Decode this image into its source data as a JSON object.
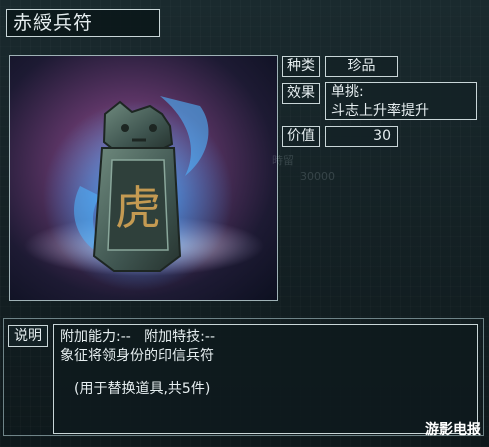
{
  "item": {
    "name": "赤綬兵符",
    "category_label": "种类",
    "category_value": "珍品",
    "effect_label": "效果",
    "effect_line1": "单挑:",
    "effect_line2": "斗志上升率提升",
    "value_label": "价值",
    "value_value": "30",
    "image_glyph": "虎"
  },
  "description": {
    "label": "说明",
    "line1": "附加能力:--   附加特技:--",
    "line2": "象征将领身份的印信兵符",
    "line3": "(用于替换道具,共5件)"
  },
  "ghost_text": {
    "a": "時留",
    "b": "30000"
  },
  "watermark": "游影电报",
  "colors": {
    "border": "#c9d6d8",
    "background": "#0f1a1d",
    "glow": "#3aa8ff",
    "token_gold": "#c49a52"
  }
}
